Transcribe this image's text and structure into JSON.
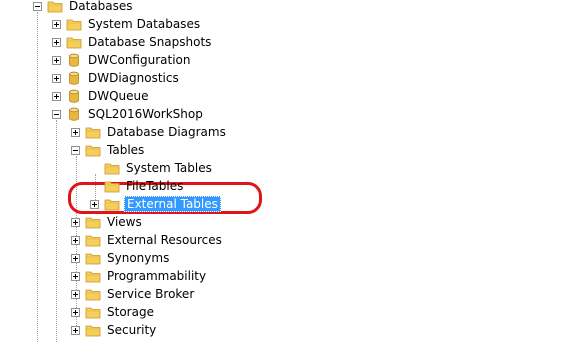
{
  "tree": {
    "root": {
      "label": "Databases",
      "icon": "folder-icon",
      "expanded": true
    },
    "root_children": [
      {
        "label": "System Databases",
        "icon": "folder-icon",
        "expanded": false
      },
      {
        "label": "Database Snapshots",
        "icon": "folder-icon",
        "expanded": false
      },
      {
        "label": "DWConfiguration",
        "icon": "database-icon",
        "expanded": false
      },
      {
        "label": "DWDiagnostics",
        "icon": "database-icon",
        "expanded": false
      },
      {
        "label": "DWQueue",
        "icon": "database-icon",
        "expanded": false
      },
      {
        "label": "SQL2016WorkShop",
        "icon": "database-icon",
        "expanded": true
      }
    ],
    "db_children": [
      {
        "label": "Database Diagrams",
        "icon": "folder-icon",
        "expanded": false
      },
      {
        "label": "Tables",
        "icon": "folder-icon",
        "expanded": true
      },
      {
        "label": "Views",
        "icon": "folder-icon",
        "expanded": false
      },
      {
        "label": "External Resources",
        "icon": "folder-icon",
        "expanded": false
      },
      {
        "label": "Synonyms",
        "icon": "folder-icon",
        "expanded": false
      },
      {
        "label": "Programmability",
        "icon": "folder-icon",
        "expanded": false
      },
      {
        "label": "Service Broker",
        "icon": "folder-icon",
        "expanded": false
      },
      {
        "label": "Storage",
        "icon": "folder-icon",
        "expanded": false
      },
      {
        "label": "Security",
        "icon": "folder-icon",
        "expanded": false
      }
    ],
    "tables_children": [
      {
        "label": "System Tables",
        "icon": "folder-icon",
        "expanded": false,
        "has_children": false
      },
      {
        "label": "FileTables",
        "icon": "folder-icon",
        "expanded": false,
        "has_children": false
      },
      {
        "label": "External Tables",
        "icon": "folder-icon",
        "expanded": false,
        "has_children": true,
        "selected": true
      }
    ]
  },
  "colors": {
    "folder_fill": "#f5cf5a",
    "folder_dark": "#d8a531",
    "database_fill": "#e8b83a",
    "selection": "#3399ff",
    "annotation_red": "#e0141a"
  }
}
